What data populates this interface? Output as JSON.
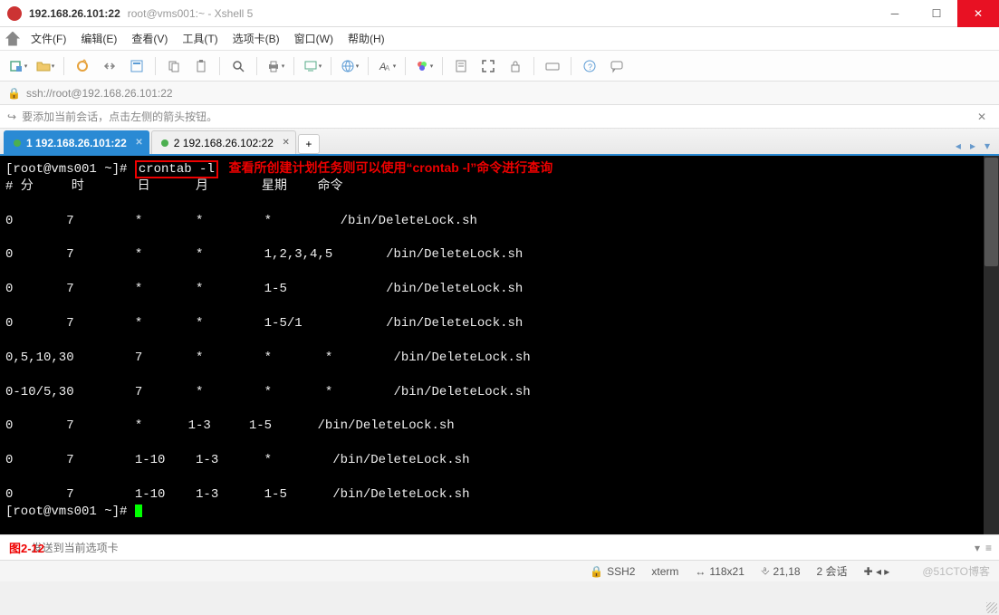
{
  "title": {
    "host": "192.168.26.101:22",
    "subtitle": "root@vms001:~ - Xshell 5"
  },
  "menu": {
    "file": "文件(F)",
    "edit": "编辑(E)",
    "view": "查看(V)",
    "tools": "工具(T)",
    "tabs": "选项卡(B)",
    "window": "窗口(W)",
    "help": "帮助(H)"
  },
  "address": {
    "url": "ssh://root@192.168.26.101:22"
  },
  "hint": {
    "text": "要添加当前会话，点击左侧的箭头按钮。"
  },
  "tabs": {
    "items": [
      {
        "label": "1 192.168.26.101:22",
        "active": true
      },
      {
        "label": "2 192.168.26.102:22",
        "active": false
      }
    ],
    "add": "+"
  },
  "terminal": {
    "prompt1": "[root@vms001 ~]# ",
    "cmd": "crontab -l",
    "annotation": "   查看所创建计划任务则可以使用“crontab -l”命令进行查询",
    "header": "# 分     时       日      月       星期    命令",
    "rows": [
      "0       7        *       *        *         /bin/DeleteLock.sh",
      "0       7        *       *        1,2,3,4,5       /bin/DeleteLock.sh",
      "0       7        *       *        1-5             /bin/DeleteLock.sh",
      "0       7        *       *        1-5/1           /bin/DeleteLock.sh",
      "0,5,10,30        7       *        *       *        /bin/DeleteLock.sh",
      "0-10/5,30        7       *        *       *        /bin/DeleteLock.sh",
      "0       7        *      1-3     1-5      /bin/DeleteLock.sh",
      "0       7        1-10    1-3      *        /bin/DeleteLock.sh",
      "0       7        1-10    1-3      1-5      /bin/DeleteLock.sh"
    ],
    "prompt2": "[root@vms001 ~]# "
  },
  "bottom": {
    "placeholder": "        发送到当前选项卡",
    "figure": "图2-12"
  },
  "status": {
    "proto": "SSH2",
    "term": "xterm",
    "size": "118x21",
    "cursor": "21,18",
    "sessions": "2 会话",
    "watermark": "@51CTO博客"
  }
}
